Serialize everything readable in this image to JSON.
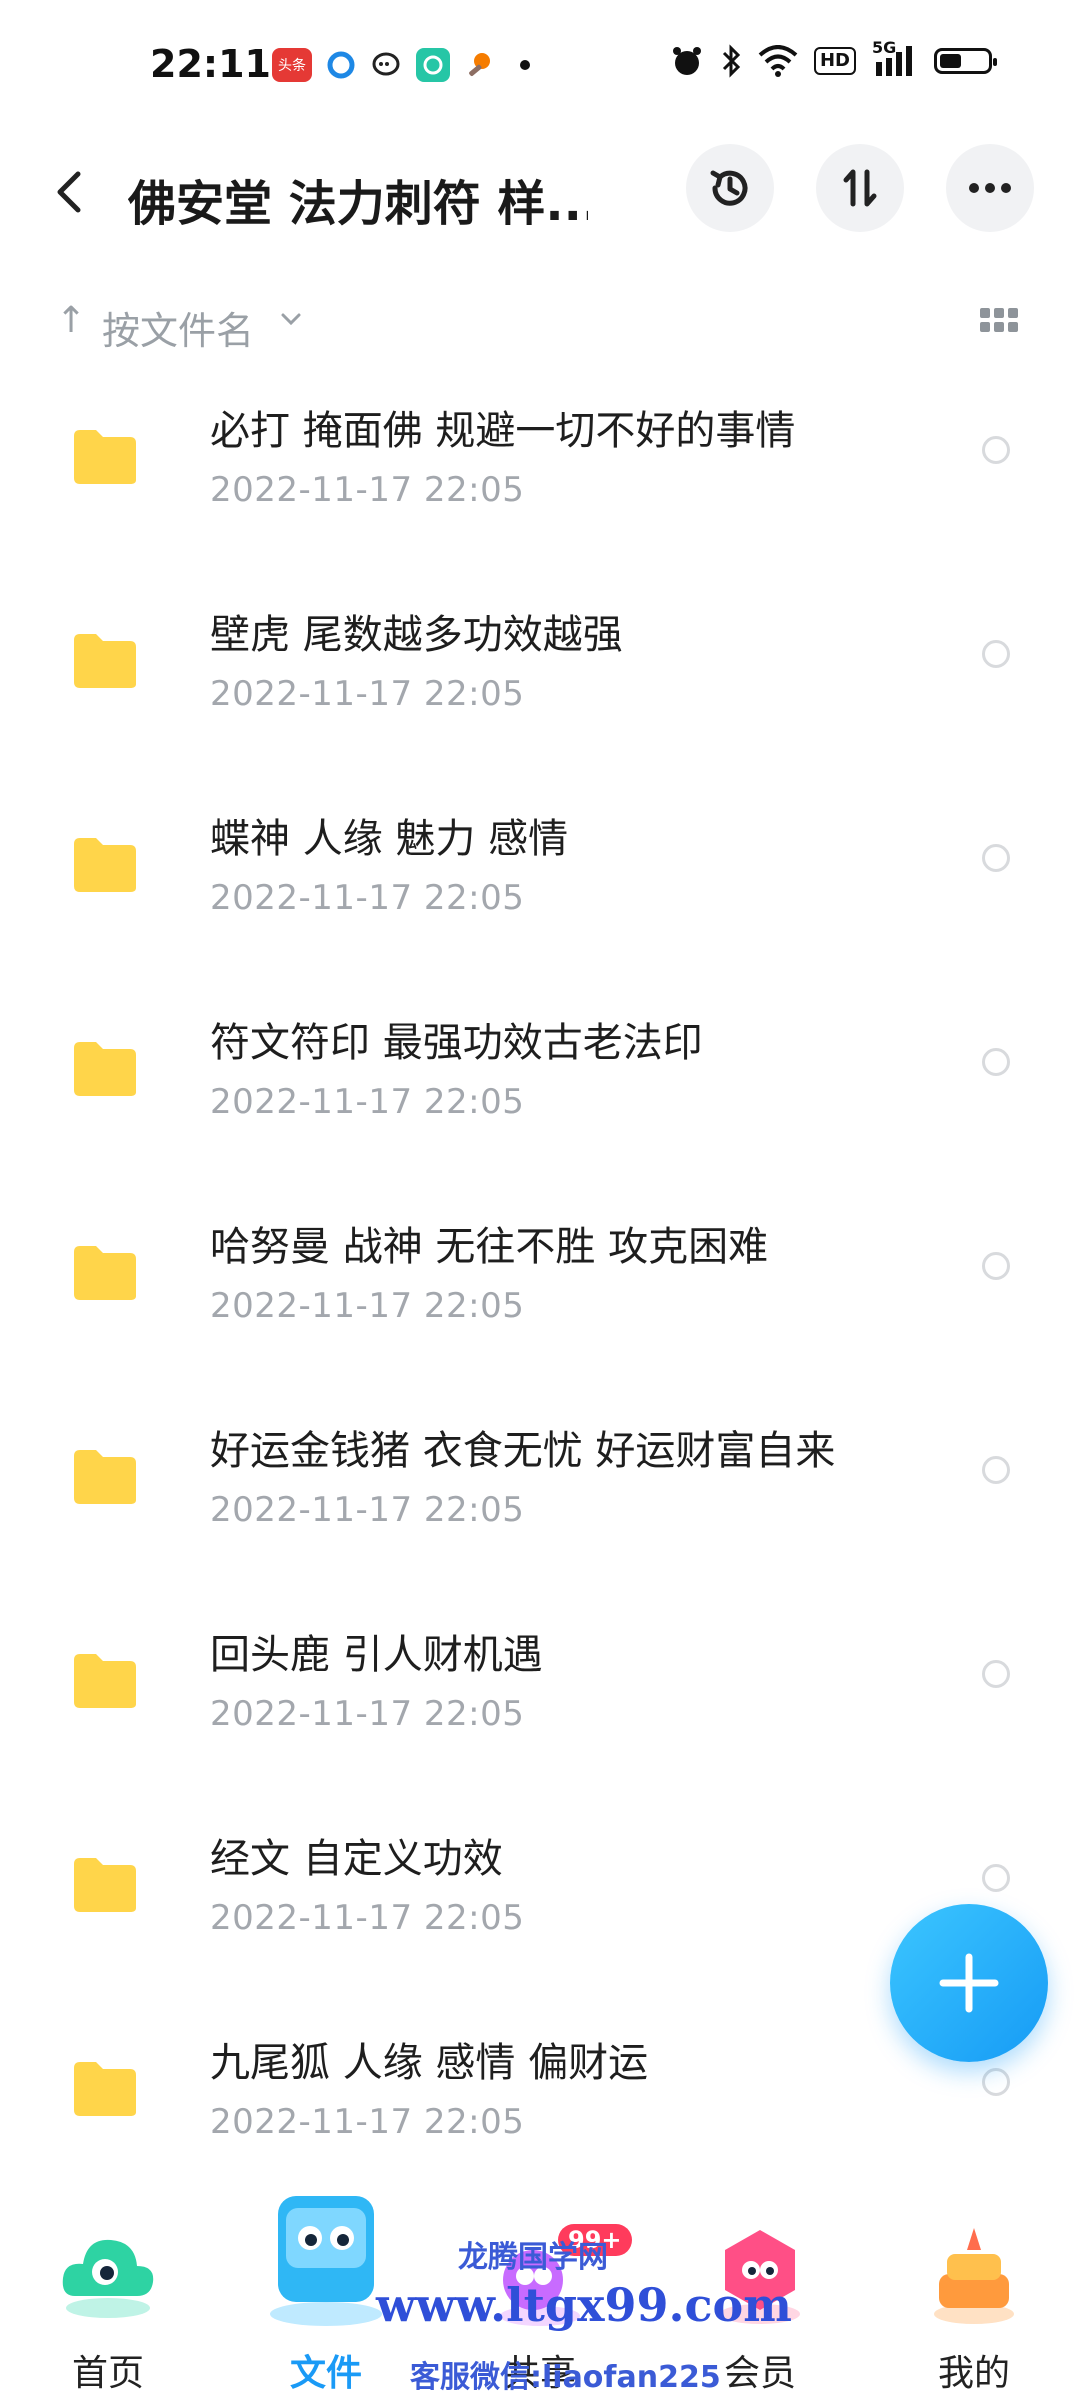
{
  "status_bar": {
    "time": "22:11",
    "app_icons": [
      "toutiao-icon",
      "browser-icon",
      "chat-icon",
      "app-icon",
      "app-icon-2"
    ],
    "toutiao_label": "头条",
    "signal_label": "5G",
    "hd_label": "HD"
  },
  "header": {
    "title": "佛安堂 法力刺符 样...",
    "back_icon": "chevron-left-icon",
    "history_icon": "history-icon",
    "sort_icon": "sort-icon",
    "more_icon": "more-icon"
  },
  "sort_bar": {
    "label": "按文件名"
  },
  "files": [
    {
      "name": "必打 掩面佛 规避一切不好的事情",
      "date": "2022-11-17  22:05"
    },
    {
      "name": "壁虎 尾数越多功效越强",
      "date": "2022-11-17  22:05"
    },
    {
      "name": "蝶神 人缘 魅力  感情",
      "date": "2022-11-17  22:05"
    },
    {
      "name": "符文符印 最强功效古老法印",
      "date": "2022-11-17  22:05"
    },
    {
      "name": "哈努曼 战神 无往不胜 攻克困难",
      "date": "2022-11-17  22:05"
    },
    {
      "name": "好运金钱猪 衣食无忧 好运财富自来",
      "date": "2022-11-17  22:05"
    },
    {
      "name": "回头鹿 引人财机遇",
      "date": "2022-11-17  22:05"
    },
    {
      "name": "经文  自定义功效",
      "date": "2022-11-17  22:05"
    },
    {
      "name": "九尾狐 人缘 感情 偏财运",
      "date": "2022-11-17  22:05"
    }
  ],
  "bottom_nav": [
    {
      "label": "首页",
      "icon": "home-cloud-icon"
    },
    {
      "label": "文件",
      "icon": "files-icon",
      "active": true
    },
    {
      "label": "共享",
      "icon": "share-icon",
      "badge": "99+"
    },
    {
      "label": "会员",
      "icon": "vip-icon"
    },
    {
      "label": "我的",
      "icon": "profile-icon"
    }
  ],
  "watermark": {
    "line1": "龙腾国学网",
    "line2": "www.ltgx99.com",
    "line3": "客服微信:liaofan225"
  },
  "colors": {
    "accent": "#1a9af6",
    "folder": "#ffd54a",
    "date_text": "#a3a7ad"
  }
}
